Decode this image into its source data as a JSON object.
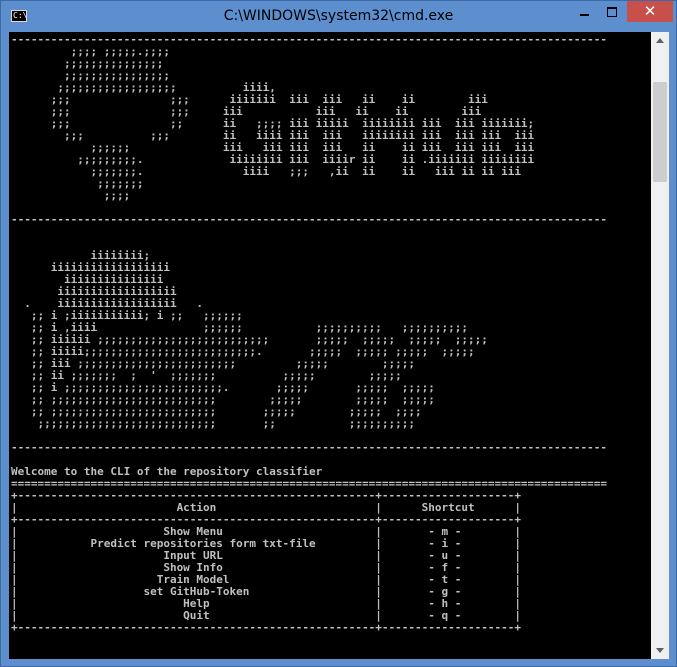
{
  "window": {
    "title": "C:\\WINDOWS\\system32\\cmd.exe",
    "icon_text": "C:\\",
    "close_glyph": "✕"
  },
  "console": {
    "lines": [
      "------------------------------------------------------------------------------------------",
      "         ;;;; ;;;;;.;;;;",
      "        ;;;;;;;;;;;;;;;",
      "        ;;;;;;;;;;;;;;;;",
      "       ;;;;;;;;;;;;;;;;;;          iiii,",
      "      ;;;               ;;;      iiiiiii  iii  iii   ii    ii        iii",
      "      ;;;               ;;;     iii           iii   ii    ii        iii",
      "      ;;;               ;;      ii   ;;;; iii iiiii  iiiiiiii iii  iii iiiiiii;",
      "        ;;;          ;;;        ii   iiii iii  iii   iiiiiiii iii  iii iii  iii",
      "            ;;;;;;              iii   iii iii  iii   ii    ii iii  iii iii  iii",
      "          ;;;;;;;;;.             iiiiiiii iii  iiiir ii    ii .iiiiiii iiiiiiii",
      "            ;;;;;;;.               iiii   ;;;   ,ii  ii    ii   iii ii ii iii",
      "             ;;;;;;;",
      "              ;;;;",
      "",
      "------------------------------------------------------------------------------------------",
      "",
      "",
      "            iiiiiiii;",
      "      iiiiiiiiiiiiiiiiii",
      "        iiiiiiiiiiiiiii",
      "       iiiiiiiiiiiiiiiiii",
      "  .    iiiiiiiiiiiiiiiiii   .",
      "   ;; i ;iiiiiiiiiii; i ;;   ;;;;;;",
      "   ;; i ,iiii                ;;;;;;           ;;;;;;;;;;   ;;;;;;;;;;",
      "   ;; iiiiii ;;;;;;;;;;;;;;;;;;;;;;;;;;       ;;;;;  ;;;;;  ;;;;;  ;;;;;",
      "   ;; iiiii;;;;;;;;;;;;;;;;;;;;;;;;;;.       ;;;;;  ;;;;; ;;;;;  ;;;;;",
      "   ;; iii ;;;;;;;;;;;;;;;;;;;;;;;;         ;;;;;        ;;;;;",
      "   ;; ii ;;;;;;;  ;  '  ;;;;;;;          ;;;;;        ;;;;;",
      "   ;; i ;;;;;;;;;;;;;;;;;;;;;;;;.       ;;;;;       ;;;;;  ;;;;;",
      "   ;; ;;;;;;;;;;;;;;;;;;;;;;;;;        ;;;;;        ;;;;;  ;;;;;",
      "   ;; ;;;;;;;;;;;;;;;;;;;;;;;;;       ;;;;;        ;;;;;  ;;;;",
      "    ;;;;;;;;;;;;;;;;;;;;;;;;;;;       ;;           ;;;;;;;;;;",
      "",
      "------------------------------------------------------------------------------------------",
      "",
      "Welcome to the CLI of the repository classifier",
      "==========================================================================================",
      "+------------------------------------------------------+--------------------+",
      "|                        Action                        |      Shortcut      |",
      "+------------------------------------------------------+--------------------+",
      "|                      Show Menu                       |       - m -        |",
      "|           Predict repositories form txt-file         |       - i -        |",
      "|                      Input URL                       |       - u -        |",
      "|                      Show Info                       |       - f -        |",
      "|                     Train Model                      |       - t -        |",
      "|                   set GitHub-Token                   |       - g -        |",
      "|                         Help                         |       - h -        |",
      "|                         Quit                         |       - q -        |",
      "+------------------------------------------------------+--------------------+"
    ]
  }
}
